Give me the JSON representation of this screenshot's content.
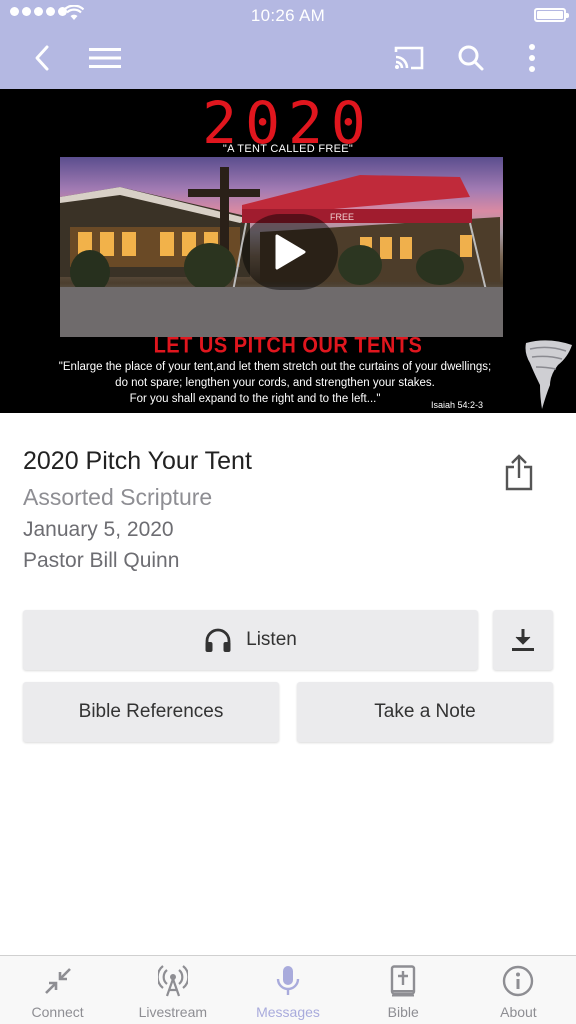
{
  "status_bar": {
    "time": "10:26 AM"
  },
  "nav": {
    "back_icon": "chevron-left-icon",
    "menu_icon": "hamburger-icon",
    "cast_icon": "cast-icon",
    "search_icon": "search-icon",
    "more_icon": "kebab-icon"
  },
  "hero": {
    "year": "2020",
    "tagline": "\"A TENT CALLED FREE\"",
    "tent_text": "FREE",
    "headline": "LET US PITCH OUR TENTS",
    "verse_line1": "\"Enlarge the place of your tent,and let them stretch out the curtains of your dwellings;",
    "verse_line2": "do not spare; lengthen your cords, and strengthen your stakes.",
    "verse_line3": "For you shall expand to the right and to the left...\"",
    "verse_ref": "Isaiah 54:2-3"
  },
  "message": {
    "title": "2020 Pitch Your Tent",
    "series": "Assorted Scripture",
    "date": "January 5, 2020",
    "speaker": "Pastor Bill Quinn"
  },
  "actions": {
    "listen_label": "Listen",
    "bible_refs_label": "Bible References",
    "note_label": "Take a Note"
  },
  "tabs": [
    {
      "label": "Connect",
      "icon": "connect-icon"
    },
    {
      "label": "Livestream",
      "icon": "livestream-icon"
    },
    {
      "label": "Messages",
      "icon": "microphone-icon",
      "active": true
    },
    {
      "label": "Bible",
      "icon": "bible-icon"
    },
    {
      "label": "About",
      "icon": "info-icon"
    }
  ],
  "colors": {
    "header": "#b4b8e2",
    "active_tab": "#a9abdc",
    "hero_red": "#e0161e"
  }
}
